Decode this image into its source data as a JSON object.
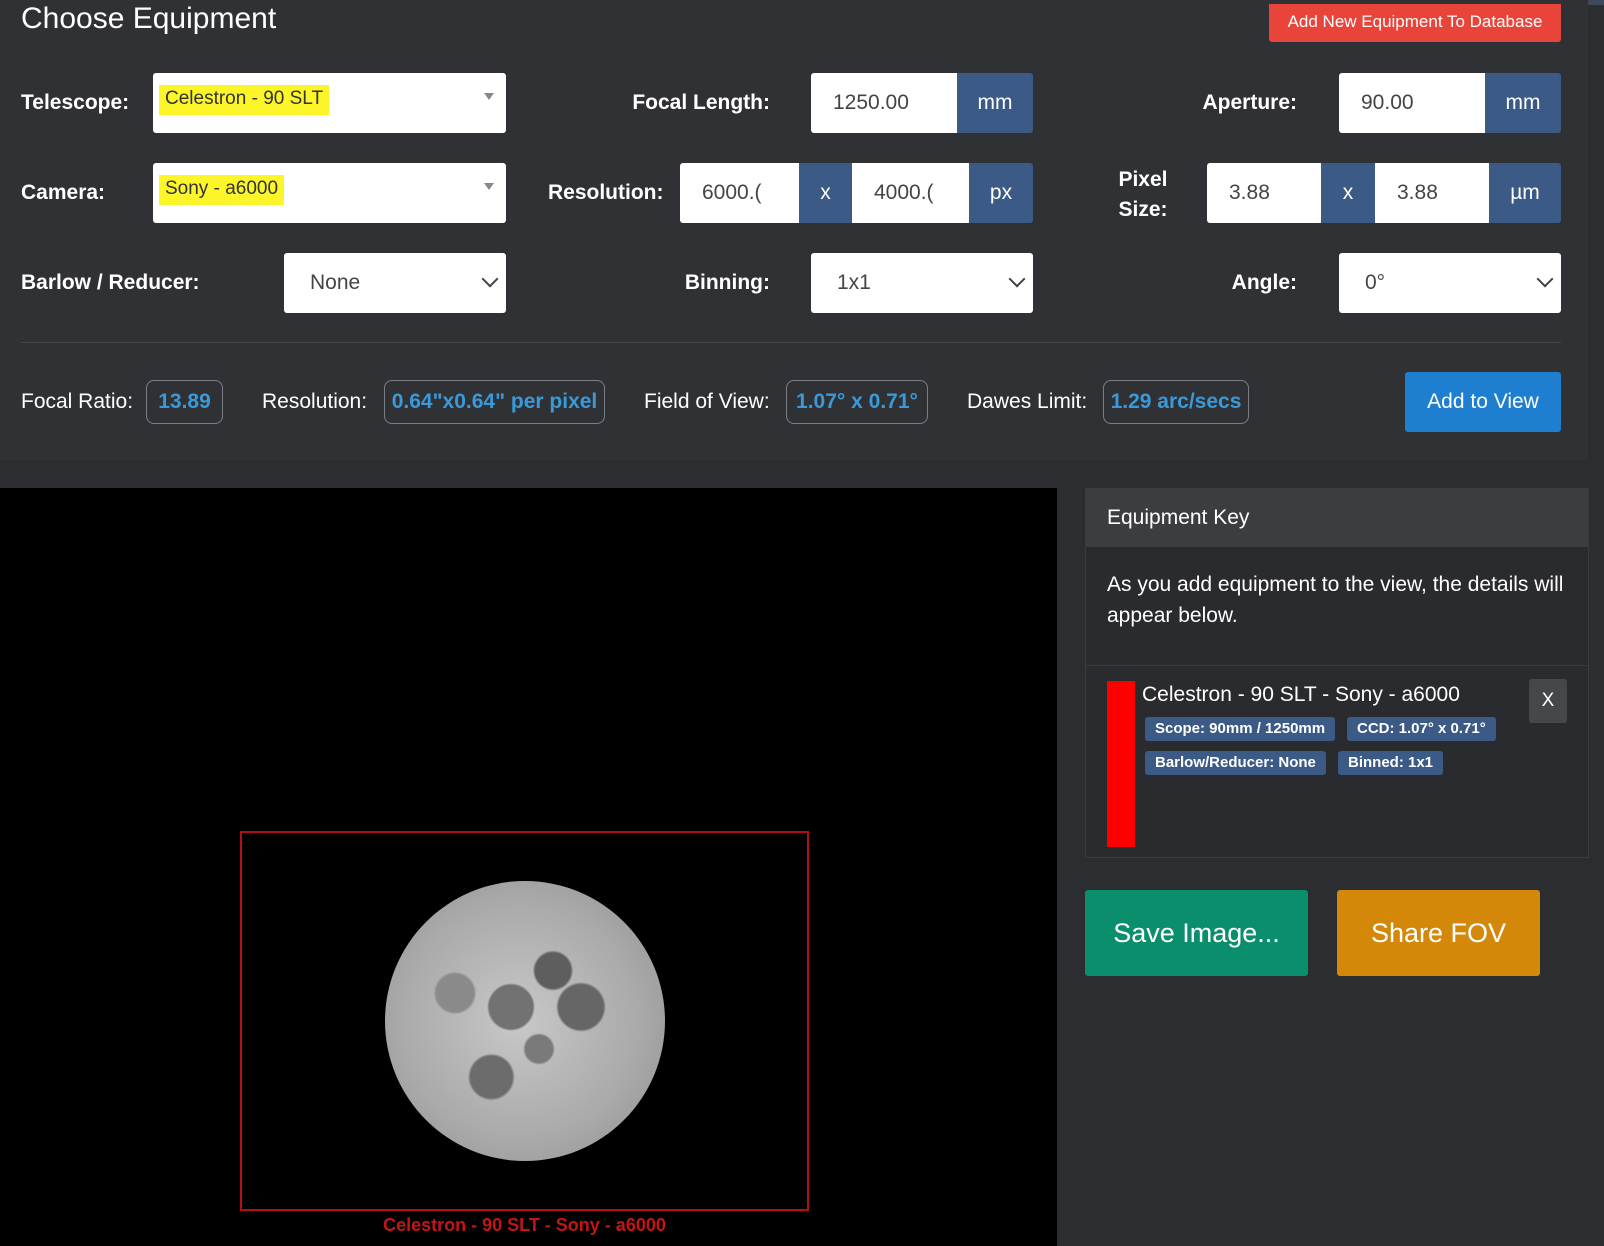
{
  "header": {
    "title": "Choose Equipment",
    "add_db_button": "Add New Equipment To Database"
  },
  "telescope": {
    "label": "Telescope:",
    "value": "Celestron - 90 SLT"
  },
  "camera": {
    "label": "Camera:",
    "value": "Sony - a6000"
  },
  "barlow": {
    "label": "Barlow / Reducer:",
    "value": "None"
  },
  "focal_length": {
    "label": "Focal Length:",
    "value": "1250.00",
    "unit": "mm"
  },
  "resolution_input": {
    "label": "Resolution:",
    "width": "6000.(",
    "height": "4000.(",
    "sep": "x",
    "unit": "px"
  },
  "binning": {
    "label": "Binning:",
    "value": "1x1"
  },
  "aperture": {
    "label": "Aperture:",
    "value": "90.00",
    "unit": "mm"
  },
  "pixel_size": {
    "label_line1": "Pixel",
    "label_line2": "Size:",
    "width": "3.88",
    "height": "3.88",
    "sep": "x",
    "unit": "µm"
  },
  "angle": {
    "label": "Angle:",
    "value": "0°"
  },
  "stats": {
    "focal_ratio_label": "Focal Ratio:",
    "focal_ratio_value": "13.89",
    "resolution_label": "Resolution:",
    "resolution_value": "0.64\"x0.64\" per pixel",
    "fov_label": "Field of View:",
    "fov_value": "1.07° x 0.71°",
    "dawes_label": "Dawes Limit:",
    "dawes_value": "1.29 arc/secs",
    "add_to_view_button": "Add to View"
  },
  "viewer": {
    "fov_caption": "Celestron - 90 SLT - Sony - a6000"
  },
  "equipment_key": {
    "heading": "Equipment Key",
    "description": "As you add equipment to the view, the details will appear below.",
    "entry": {
      "title": "Celestron - 90 SLT - Sony - a6000",
      "color": "#ff0000",
      "badges": [
        "Scope: 90mm / 1250mm",
        "CCD: 1.07° x 0.71°",
        "Barlow/Reducer: None",
        "Binned: 1x1"
      ],
      "remove_label": "X"
    }
  },
  "actions": {
    "save_button": "Save Image...",
    "share_button": "Share FOV"
  },
  "colors": {
    "accent_blue": "#1e7fd1",
    "addon_blue": "#3b5b86",
    "danger": "#e8443a",
    "save_green": "#0b8e6c",
    "share_orange": "#d38809",
    "highlight_yellow": "#fbf52a"
  }
}
